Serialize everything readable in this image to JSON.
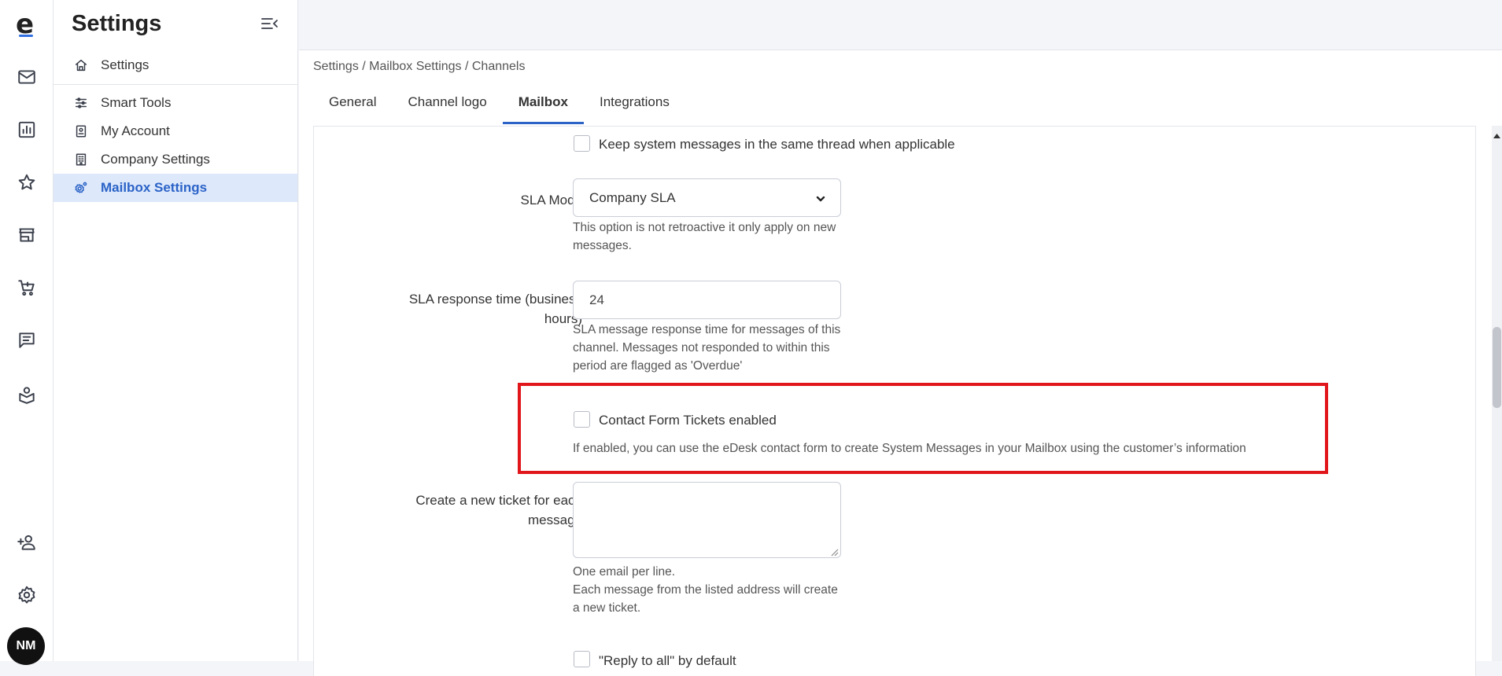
{
  "rail": {
    "logo": "e",
    "avatar": "NM",
    "icons": [
      "mail-icon",
      "reports-icon",
      "star-icon",
      "store-icon",
      "cart-icon",
      "chat-icon",
      "knowledge-icon",
      "add-user-icon",
      "gear-icon"
    ]
  },
  "sidebar": {
    "title": "Settings",
    "items": [
      {
        "label": "Settings",
        "icon": "home-icon"
      },
      {
        "label": "Smart Tools",
        "icon": "sliders-icon"
      },
      {
        "label": "My Account",
        "icon": "id-card-icon"
      },
      {
        "label": "Company Settings",
        "icon": "building-icon"
      },
      {
        "label": "Mailbox Settings",
        "icon": "mailbox-settings-icon",
        "active": true
      }
    ]
  },
  "main": {
    "breadcrumb": "Settings / Mailbox Settings / Channels",
    "tabs": [
      {
        "label": "General"
      },
      {
        "label": "Channel logo"
      },
      {
        "label": "Mailbox",
        "active": true
      },
      {
        "label": "Integrations"
      }
    ]
  },
  "form": {
    "keep_system_messages": {
      "label": "Keep system messages in the same thread when applicable",
      "checked": false
    },
    "sla_mode": {
      "label": "SLA Mode",
      "value": "Company SLA",
      "help": "This option is not retroactive it only apply on new messages."
    },
    "sla_response_time": {
      "label": "SLA response time (business hours)",
      "value": "24",
      "help": "SLA message response time for messages of this channel. Messages not responded to within this period are flagged as 'Overdue'"
    },
    "contact_form": {
      "label": "Contact Form Tickets enabled",
      "checked": false,
      "help": "If enabled, you can use the eDesk contact form to create System Messages in your Mailbox using the customer’s information"
    },
    "new_ticket_each_message": {
      "label": "Create a new ticket for each message",
      "value": "",
      "help_line1": "One email per line.",
      "help_line2": "Each message from the listed address will create a new ticket."
    },
    "reply_to_all": {
      "label": "\"Reply to all\" by default",
      "checked": false
    }
  },
  "colors": {
    "accent": "#2b63c7",
    "highlight": "#e0161b",
    "active_bg": "#dde8fb"
  }
}
